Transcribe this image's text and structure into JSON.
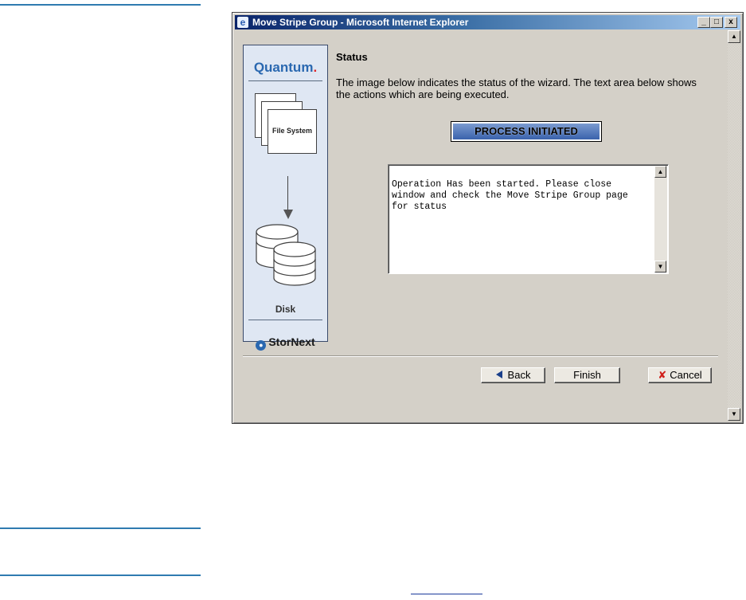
{
  "window": {
    "title": "Move Stripe Group - Microsoft Internet Explorer",
    "minimize": "_",
    "maximize": "□",
    "close": "x"
  },
  "side_panel": {
    "brand": "Quantum",
    "brand_dot": ".",
    "file_system_label": "File System",
    "disk_label": "Disk",
    "product": "StorNext"
  },
  "main": {
    "heading": "Status",
    "description": "The image below indicates the status of the wizard. The text area below shows the actions which are being executed.",
    "status_badge": "PROCESS INITIATED",
    "log_text": "Operation Has been started. Please close window and check the Move Stripe Group page for status"
  },
  "buttons": {
    "back": "Back",
    "finish": "Finish",
    "cancel": "Cancel"
  },
  "colors": {
    "titlebar_start": "#0a246a",
    "badge": "#3a62ac",
    "brand_blue": "#2a68b0",
    "cancel_x": "#d0201a"
  }
}
